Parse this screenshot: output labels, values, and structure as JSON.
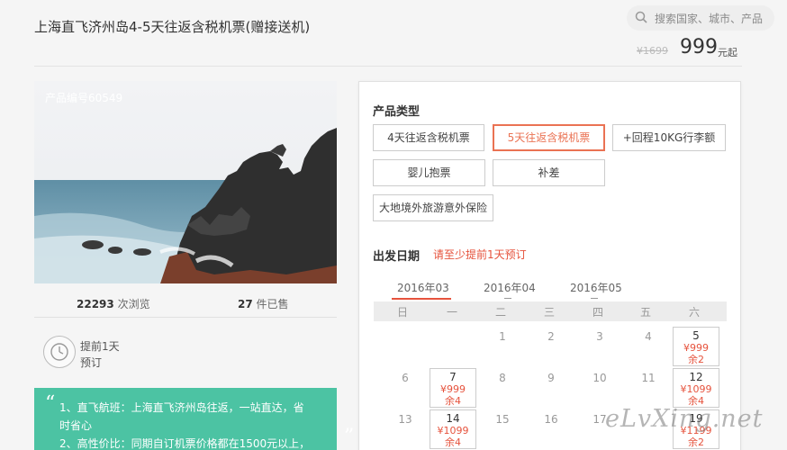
{
  "header": {
    "title": "上海直飞济州岛4-5天往返含税机票(赠接送机)",
    "search_placeholder": "搜索国家、城市、产品",
    "old_price": "¥1699",
    "price": "999",
    "price_suffix": "元起"
  },
  "gallery": {
    "product_code": "产品编号60549"
  },
  "stats": {
    "views_count": "22293",
    "views_label": " 次浏览",
    "sold_count": "27",
    "sold_label": " 件已售"
  },
  "advance": {
    "line1": "提前1天",
    "line2": "预订"
  },
  "highlights": {
    "line1": "1、直飞航班：上海直飞济州岛往返，一站直达，省时省心",
    "line2": "2、高性价比：同期自订机票价格都在1500元以上，"
  },
  "panel": {
    "product_type_label": "产品类型",
    "options": [
      {
        "label": "4天往返含税机票",
        "selected": false
      },
      {
        "label": "5天往返含税机票",
        "selected": true
      },
      {
        "label": "+回程10KG行李额",
        "selected": false
      },
      {
        "label": "婴儿抱票",
        "selected": false
      },
      {
        "label": "补差",
        "selected": false
      },
      {
        "label": "大地境外旅游意外保险",
        "selected": false
      }
    ],
    "date_label": "出发日期",
    "date_hint": "请至少提前1天预订",
    "months": [
      "2016年03",
      "2016年04",
      "2016年05"
    ],
    "active_month": "2016年03",
    "weekdays": [
      "日",
      "一",
      "二",
      "三",
      "四",
      "五",
      "六"
    ]
  },
  "calendar": {
    "plain_days": [
      "1",
      "2",
      "3",
      "4",
      "6",
      "8",
      "9",
      "10",
      "11",
      "13",
      "15",
      "16",
      "17"
    ],
    "bookable": [
      {
        "day": "5",
        "price": "¥999",
        "stock": "余2"
      },
      {
        "day": "7",
        "price": "¥999",
        "stock": "余4"
      },
      {
        "day": "12",
        "price": "¥1099",
        "stock": "余4"
      },
      {
        "day": "14",
        "price": "¥1099",
        "stock": "余4"
      },
      {
        "day": "19",
        "price": "¥1199",
        "stock": "余2"
      }
    ]
  },
  "watermark": "eLvXing.net",
  "colors": {
    "accent": "#e6533d",
    "green": "#4cc3a3"
  }
}
